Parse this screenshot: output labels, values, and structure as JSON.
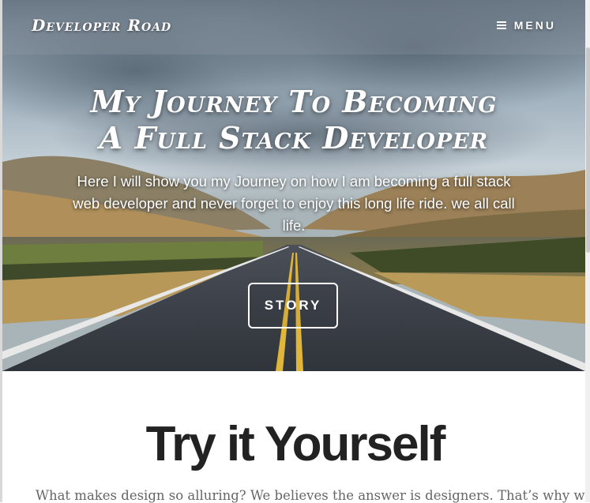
{
  "header": {
    "brand": "Developer Road",
    "menu_label": "MENU"
  },
  "hero": {
    "title_line1": "My Journey To Becoming",
    "title_line2": "A Full Stack Developer",
    "subtitle": "Here I will show you my Journey on how I am becoming a full stack web developer and never forget to enjoy this long life ride. we all call life.",
    "button_label": "STORY"
  },
  "section": {
    "title": "Try it Yourself",
    "text": "What makes design so alluring? We believes the answer is designers. That’s why we"
  },
  "colors": {
    "sky": "#8a9aa8",
    "road": "#3a3f46",
    "center_line": "#e0b63a",
    "title_text": "#222222"
  }
}
